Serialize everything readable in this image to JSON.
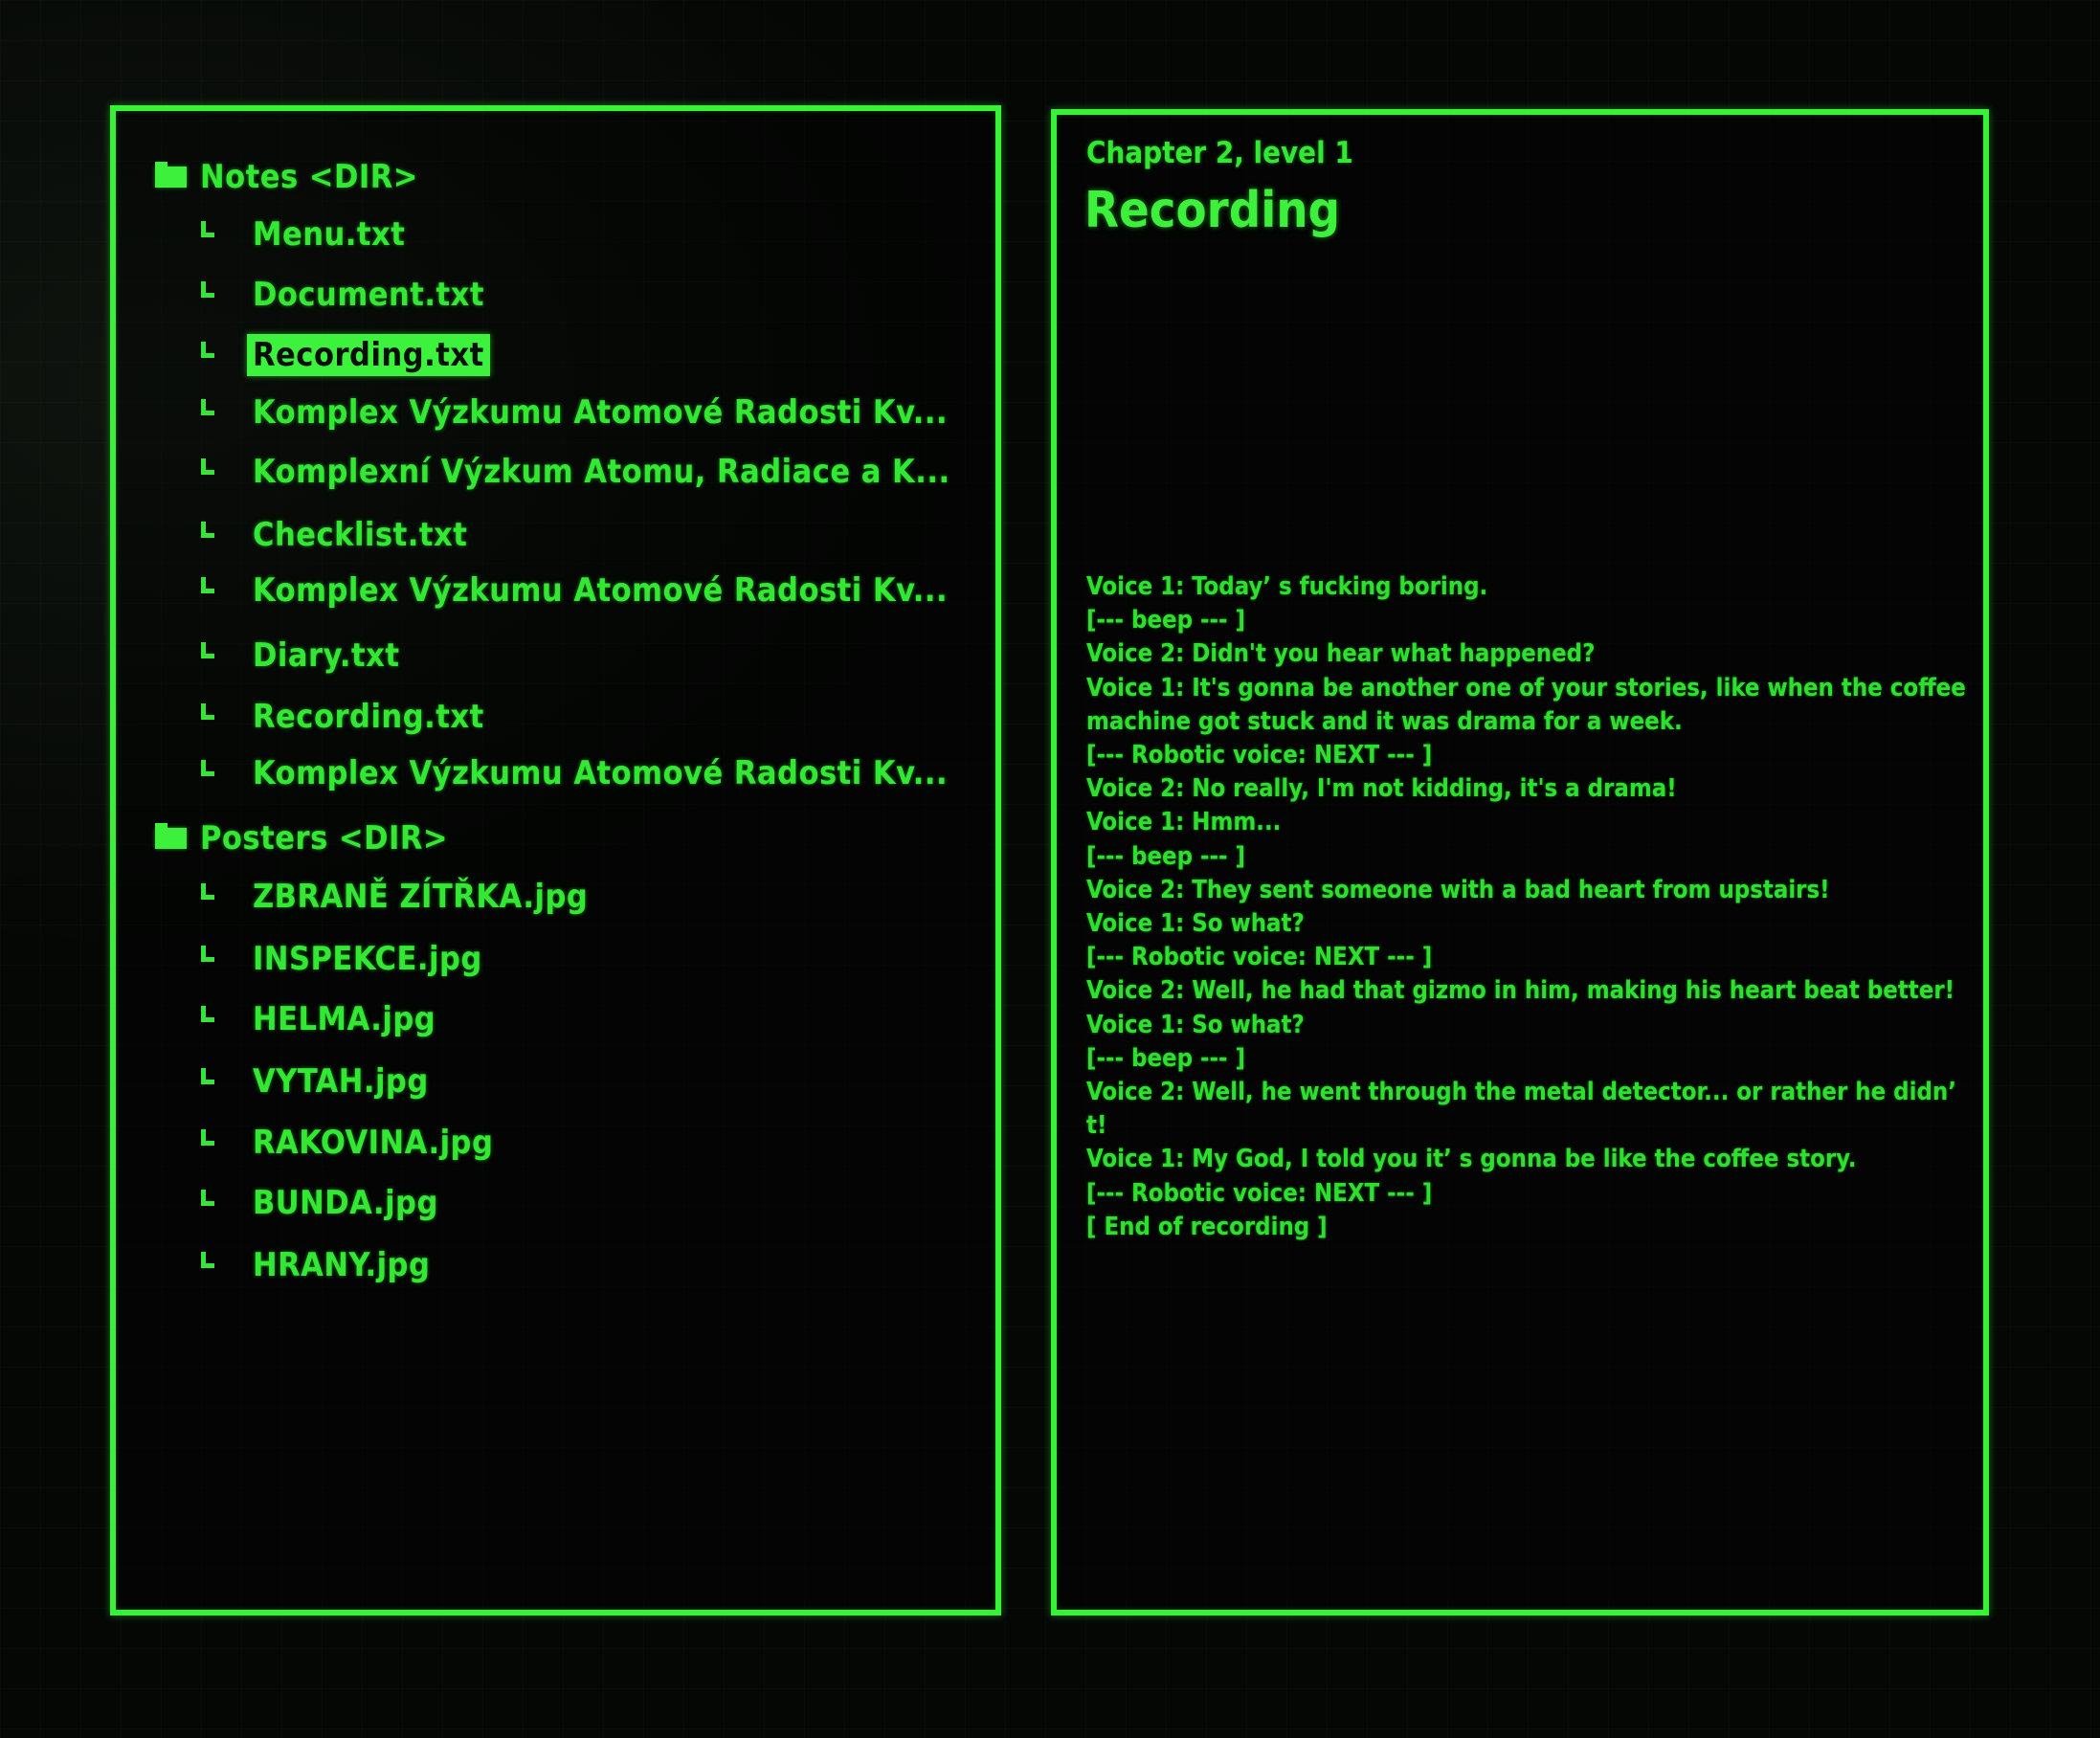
{
  "file_browser": {
    "directories": [
      {
        "name": "Notes <DIR>",
        "icon": "folder-icon",
        "files": [
          {
            "name": "Menu.txt"
          },
          {
            "name": "Document.txt"
          },
          {
            "name": "Recording.txt",
            "selected": true
          },
          {
            "name": "Komplex Výzkumu Atomové Radosti Kv..."
          },
          {
            "name": "Komplexní Výzkum Atomu, Radiace a K..."
          },
          {
            "name": "Checklist.txt"
          },
          {
            "name": "Komplex Výzkumu Atomové Radosti Kv..."
          },
          {
            "name": "Diary.txt"
          },
          {
            "name": "Recording.txt"
          },
          {
            "name": "Komplex Výzkumu Atomové Radosti Kv..."
          }
        ]
      },
      {
        "name": "Posters <DIR>",
        "icon": "folder-icon",
        "files": [
          {
            "name": "ZBRANĚ ZÍTŘKA.jpg"
          },
          {
            "name": "INSPEKCE.jpg"
          },
          {
            "name": "HELMA.jpg"
          },
          {
            "name": "VYTAH.jpg"
          },
          {
            "name": "RAKOVINA.jpg"
          },
          {
            "name": "BUNDA.jpg"
          },
          {
            "name": "HRANY.jpg"
          }
        ]
      }
    ],
    "connector_glyph": "└"
  },
  "document": {
    "chapter": "Chapter 2, level 1",
    "title": "Recording",
    "lines": [
      "Voice 1: Today’ s fucking boring.",
      "[--- beep --- ]",
      "Voice 2: Didn't you hear what happened?",
      "Voice 1: It's gonna be another one of your stories, like when the coffee machine got stuck and it was drama for a week.",
      "[--- Robotic voice: NEXT --- ]",
      "Voice 2: No really, I'm not kidding, it's a drama!",
      "Voice 1: Hmm...",
      "[--- beep --- ]",
      "Voice 2: They sent someone with a bad heart from upstairs!",
      "Voice 1: So what?",
      "[--- Robotic voice: NEXT --- ]",
      "Voice 2: Well, he had that gizmo in him, making his heart beat better!",
      "Voice 1: So what?",
      "[--- beep --- ]",
      "Voice 2: Well, he went through the metal detector... or rather he didn’ t!",
      "Voice 1: My God, I told you it’ s gonna be like the coffee story.",
      "[--- Robotic voice: NEXT --- ]",
      "[ End of recording ]"
    ]
  },
  "colors": {
    "phosphor_green": "#33e833",
    "highlight": "#3df23d",
    "background": "#050705"
  }
}
